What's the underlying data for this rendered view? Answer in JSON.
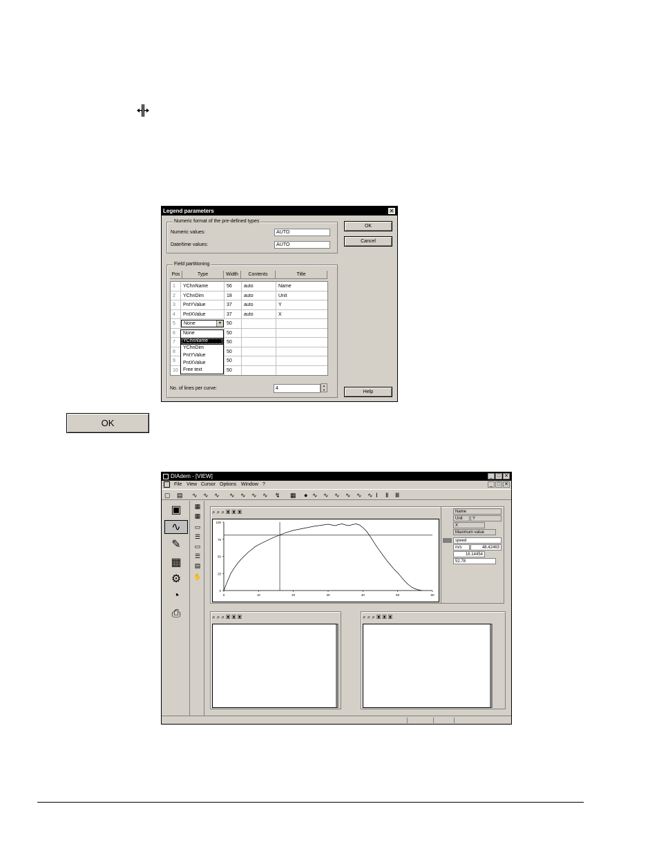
{
  "dialog": {
    "title": "Legend parameters",
    "close_glyph": "✕",
    "numeric_group_label": "Numeric format of the pre-defined types",
    "numeric_values_label": "Numeric values:",
    "numeric_values_value": "AUTO",
    "datetime_values_label": "Date/time values:",
    "datetime_values_value": "AUTO",
    "field_group_label": "Field partitioning",
    "columns": [
      "Pos",
      "Type",
      "Width",
      "Contents",
      "Title"
    ],
    "rows": [
      {
        "pos": "1",
        "type": "YChnName",
        "width": "56",
        "contents": "auto",
        "title": "Name"
      },
      {
        "pos": "2",
        "type": "YChnDim",
        "width": "18",
        "contents": "auto",
        "title": "Unit"
      },
      {
        "pos": "3",
        "type": "PntYValue",
        "width": "37",
        "contents": "auto",
        "title": "Y"
      },
      {
        "pos": "4",
        "type": "PntXValue",
        "width": "37",
        "contents": "auto",
        "title": "X"
      },
      {
        "pos": "5",
        "type": "None",
        "width": "50",
        "contents": "",
        "title": ""
      },
      {
        "pos": "6",
        "type": "",
        "width": "50",
        "contents": "",
        "title": ""
      },
      {
        "pos": "7",
        "type": "",
        "width": "50",
        "contents": "",
        "title": ""
      },
      {
        "pos": "8",
        "type": "",
        "width": "50",
        "contents": "",
        "title": ""
      },
      {
        "pos": "9",
        "type": "",
        "width": "50",
        "contents": "",
        "title": ""
      },
      {
        "pos": "10",
        "type": "",
        "width": "50",
        "contents": "",
        "title": ""
      }
    ],
    "dropdown_options": [
      "None",
      "YChnName",
      "YChnDim",
      "PntYValue",
      "PntXValue",
      "Free text"
    ],
    "dropdown_selected": "YChnName",
    "lines_per_curve_label": "No. of lines per curve:",
    "lines_per_curve_value": "4",
    "ok_label": "OK",
    "cancel_label": "Cancel",
    "help_label": "Help"
  },
  "ok_big_label": "OK",
  "app": {
    "title": "DIAdem - [VIEW]",
    "menu": [
      "File",
      "View",
      "Cursor",
      "Options",
      "Window",
      "?"
    ],
    "win_minimize": "_",
    "win_maximize": "□",
    "win_close": "✕",
    "legend": {
      "name_header": "Name",
      "unit_header": "Unit",
      "y_header": "Y",
      "x_header": "X",
      "max_header": "Maximum value",
      "channel_name": "speed",
      "unit": "m/s",
      "y_value": "48.42463",
      "x_value": "16.14454",
      "max_value": "52.78"
    }
  },
  "chart_data": {
    "type": "line",
    "x_ticks": [
      "0",
      "10",
      "20",
      "30",
      "40",
      "50",
      "60"
    ],
    "y_ticks": [
      "0",
      "25",
      "50",
      "75",
      "100"
    ],
    "xlim": [
      0,
      60
    ],
    "ylim": [
      0,
      100
    ],
    "cursor_x": 16.1,
    "cursor_y": 81,
    "series": [
      {
        "values": [
          [
            0,
            0
          ],
          [
            1,
            13
          ],
          [
            2,
            25
          ],
          [
            3,
            33
          ],
          [
            4,
            40
          ],
          [
            5,
            46
          ],
          [
            6,
            51
          ],
          [
            7,
            56
          ],
          [
            8,
            60
          ],
          [
            9,
            64
          ],
          [
            10,
            67
          ],
          [
            12,
            72
          ],
          [
            14,
            77
          ],
          [
            16,
            81
          ],
          [
            18,
            85
          ],
          [
            20,
            88
          ],
          [
            22,
            90
          ],
          [
            24,
            92
          ],
          [
            26,
            94
          ],
          [
            28,
            95.5
          ],
          [
            30,
            97
          ],
          [
            31,
            96
          ],
          [
            32,
            95
          ],
          [
            33,
            96.5
          ],
          [
            34,
            97.5
          ],
          [
            35,
            96
          ],
          [
            36,
            95
          ],
          [
            37,
            96.5
          ],
          [
            38,
            97.5
          ],
          [
            39,
            96
          ],
          [
            40,
            92
          ],
          [
            41,
            87
          ],
          [
            42,
            80
          ],
          [
            43,
            72
          ],
          [
            44,
            64
          ],
          [
            45,
            57
          ],
          [
            46,
            50
          ],
          [
            47,
            43
          ],
          [
            48,
            37
          ],
          [
            49,
            31
          ],
          [
            50,
            26
          ],
          [
            51,
            20
          ],
          [
            52,
            14
          ],
          [
            53,
            9
          ],
          [
            54,
            5
          ],
          [
            55,
            2.5
          ],
          [
            56,
            1
          ],
          [
            57,
            0
          ]
        ]
      }
    ]
  }
}
